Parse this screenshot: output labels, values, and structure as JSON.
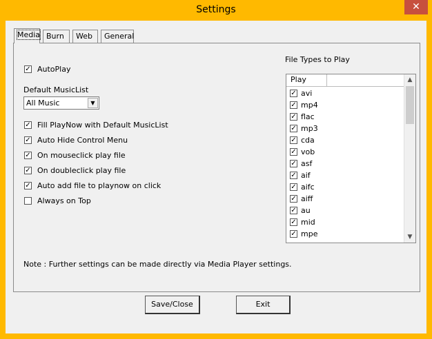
{
  "window": {
    "title": "Settings",
    "close_glyph": "✕"
  },
  "tabs": [
    {
      "label": "Media"
    },
    {
      "label": "Burn"
    },
    {
      "label": "Web"
    },
    {
      "label": "General"
    }
  ],
  "media": {
    "autoplay": {
      "label": "AutoPlay",
      "checked": true
    },
    "default_musiclist_label": "Default MusicList",
    "default_musiclist": {
      "value": "All Music"
    },
    "options": [
      {
        "label": "Fill PlayNow with Default MusicList",
        "checked": true
      },
      {
        "label": "Auto Hide Control Menu",
        "checked": true
      },
      {
        "label": "On mouseclick play file",
        "checked": true
      },
      {
        "label": "On doubleclick play file",
        "checked": true
      },
      {
        "label": "Auto add file to playnow on click",
        "checked": true
      },
      {
        "label": "Always on Top",
        "checked": false
      }
    ],
    "file_types_title": "File Types to Play",
    "file_types_column": "Play",
    "file_types": [
      {
        "label": "avi",
        "checked": true
      },
      {
        "label": "mp4",
        "checked": true
      },
      {
        "label": "flac",
        "checked": true
      },
      {
        "label": "mp3",
        "checked": true
      },
      {
        "label": "cda",
        "checked": true
      },
      {
        "label": "vob",
        "checked": true
      },
      {
        "label": "asf",
        "checked": true
      },
      {
        "label": "aif",
        "checked": true
      },
      {
        "label": "aifc",
        "checked": true
      },
      {
        "label": "aiff",
        "checked": true
      },
      {
        "label": "au",
        "checked": true
      },
      {
        "label": "mid",
        "checked": true
      },
      {
        "label": "mpe",
        "checked": true
      }
    ],
    "note": "Note : Further settings can be made directly via Media Player settings."
  },
  "buttons": {
    "save_close": "Save/Close",
    "exit": "Exit"
  },
  "colors": {
    "title_bar": "#ffb900",
    "close": "#c7503e"
  }
}
